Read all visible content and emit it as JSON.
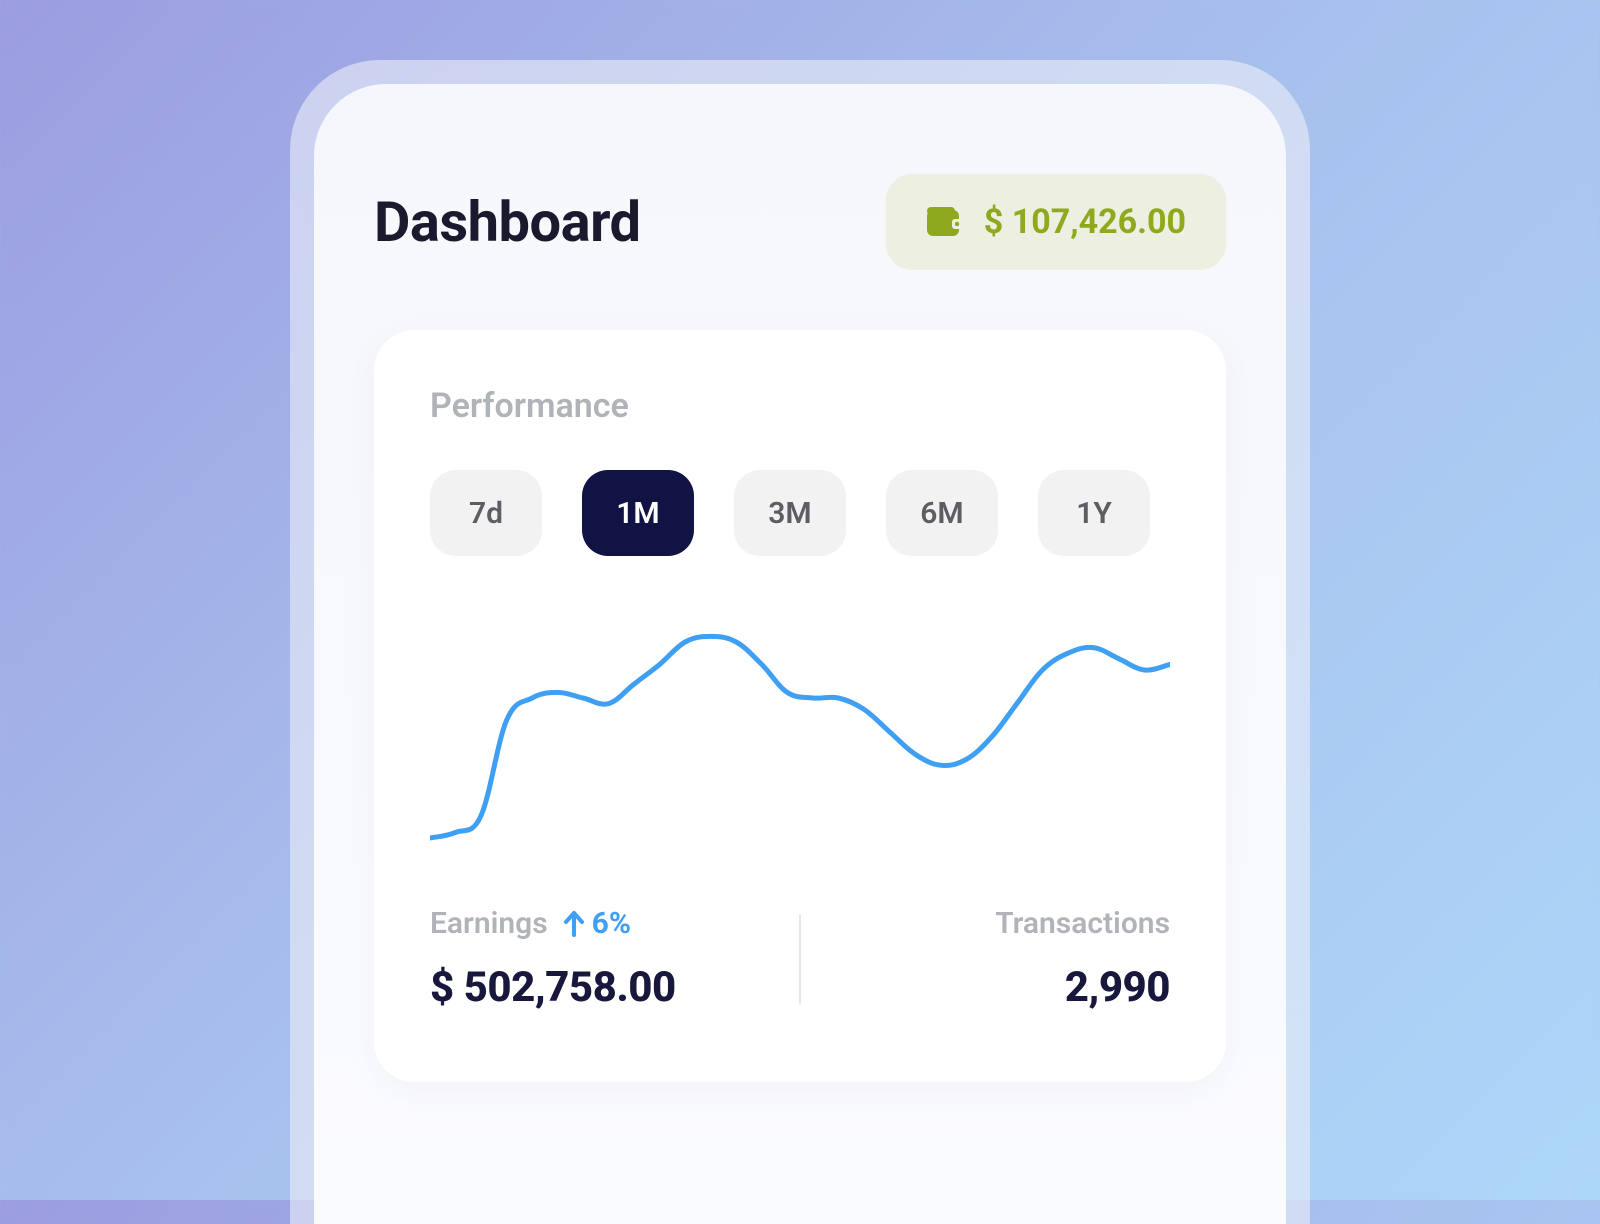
{
  "header": {
    "title": "Dashboard",
    "wallet_amount": "$ 107,426.00"
  },
  "performance": {
    "title": "Performance",
    "ranges": [
      "7d",
      "1M",
      "3M",
      "6M",
      "1Y"
    ],
    "active_range_index": 1,
    "earnings": {
      "label": "Earnings",
      "delta": "6%",
      "value": "$ 502,758.00"
    },
    "transactions": {
      "label": "Transactions",
      "value": "2,990"
    }
  },
  "colors": {
    "accent_green": "#8fa91f",
    "accent_blue": "#3f9ff3",
    "dark_navy": "#111344"
  },
  "chart_data": {
    "type": "line",
    "title": "Performance",
    "xlabel": "",
    "ylabel": "",
    "x": [
      0,
      1,
      2,
      3,
      4,
      5,
      6,
      7,
      8,
      9,
      10,
      11,
      12,
      13,
      14,
      15,
      16,
      17,
      18,
      19,
      20,
      21,
      22,
      23,
      24,
      25,
      26,
      27,
      28,
      29
    ],
    "values": [
      10,
      12,
      18,
      52,
      60,
      62,
      60,
      58,
      65,
      72,
      80,
      82,
      80,
      72,
      62,
      60,
      60,
      56,
      48,
      40,
      36,
      38,
      46,
      58,
      70,
      76,
      78,
      74,
      70,
      72
    ],
    "ylim": [
      0,
      100
    ]
  }
}
